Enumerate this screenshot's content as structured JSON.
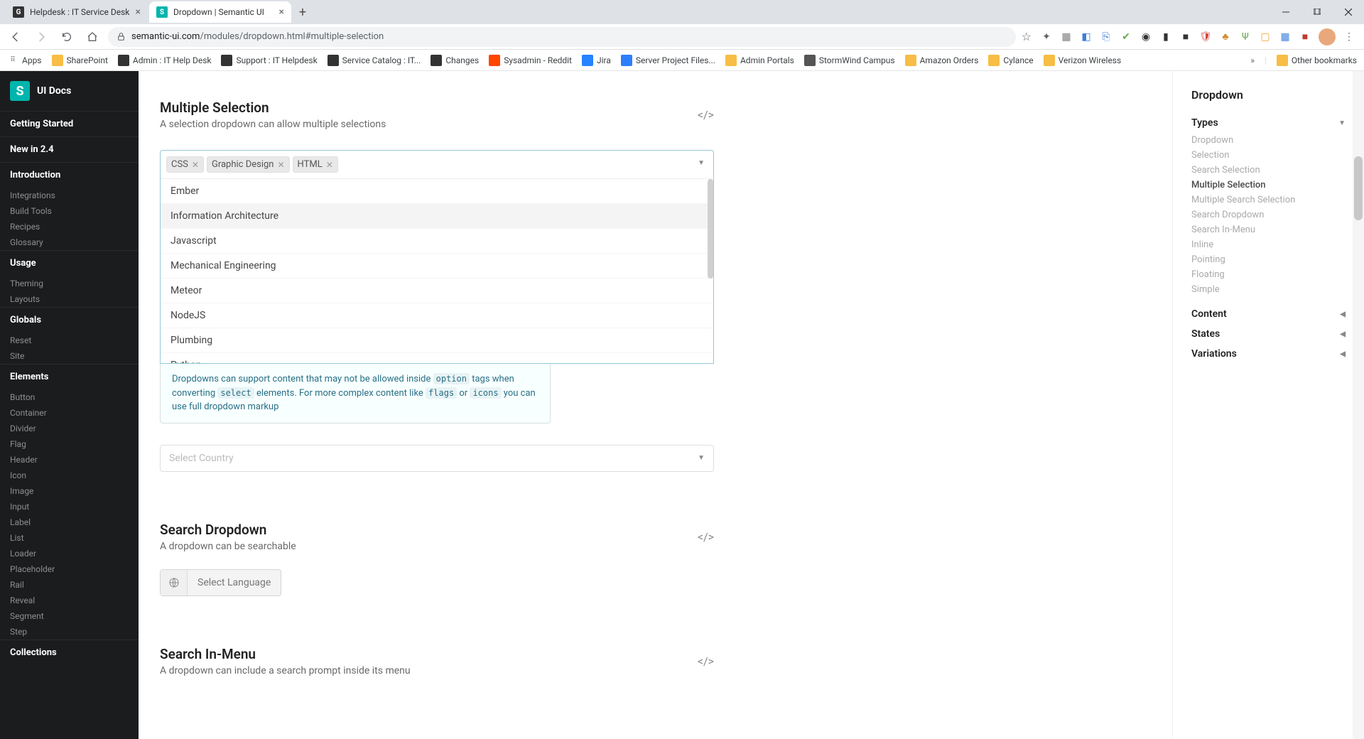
{
  "browser": {
    "tabs": [
      {
        "title": "Helpdesk : IT Service Desk",
        "active": false
      },
      {
        "title": "Dropdown | Semantic UI",
        "active": true
      }
    ],
    "url_host": "semantic-ui.com",
    "url_path": "/modules/dropdown.html#multiple-selection",
    "bookmarks": [
      "Apps",
      "SharePoint",
      "Admin : IT Help Desk",
      "Support : IT Helpdesk",
      "Service Catalog : IT...",
      "Changes",
      "Sysadmin - Reddit",
      "Jira",
      "Server Project Files...",
      "Admin Portals",
      "StormWind Campus",
      "Amazon Orders",
      "Cylance",
      "Verizon Wireless"
    ],
    "other_bookmarks": "Other bookmarks"
  },
  "sidebar": {
    "brand": "UI Docs",
    "groups": [
      {
        "header": "Getting Started",
        "items": []
      },
      {
        "header": "New in 2.4",
        "items": []
      },
      {
        "header": "Introduction",
        "items": [
          "Integrations",
          "Build Tools",
          "Recipes",
          "Glossary"
        ]
      },
      {
        "header": "Usage",
        "items": [
          "Theming",
          "Layouts"
        ]
      },
      {
        "header": "Globals",
        "items": [
          "Reset",
          "Site"
        ]
      },
      {
        "header": "Elements",
        "items": [
          "Button",
          "Container",
          "Divider",
          "Flag",
          "Header",
          "Icon",
          "Image",
          "Input",
          "Label",
          "List",
          "Loader",
          "Placeholder",
          "Rail",
          "Reveal",
          "Segment",
          "Step"
        ]
      },
      {
        "header": "Collections",
        "items": []
      }
    ]
  },
  "main": {
    "multi": {
      "title": "Multiple Selection",
      "sub": "A selection dropdown can allow multiple selections",
      "chips": [
        "CSS",
        "Graphic Design",
        "HTML"
      ],
      "options": [
        "Ember",
        "Information Architecture",
        "Javascript",
        "Mechanical Engineering",
        "Meteor",
        "NodeJS",
        "Plumbing",
        "Python"
      ],
      "hover_index": 1,
      "note_pre": "Dropdowns can support content that may not be allowed inside ",
      "note_code1": "option",
      "note_mid1": " tags when converting ",
      "note_code2": "select",
      "note_mid2": " elements. For more complex content like ",
      "note_code3": "flags",
      "note_mid3": " or ",
      "note_code4": "icons",
      "note_end": " you can use full dropdown markup"
    },
    "country_placeholder": "Select Country",
    "search": {
      "title": "Search Dropdown",
      "sub": "A dropdown can be searchable",
      "lang_label": "Select Language"
    },
    "inmenu": {
      "title": "Search In-Menu",
      "sub": "A dropdown can include a search prompt inside its menu"
    }
  },
  "toc": {
    "title": "Dropdown",
    "types_label": "Types",
    "types": [
      "Dropdown",
      "Selection",
      "Search Selection",
      "Multiple Selection",
      "Multiple Search Selection",
      "Search Dropdown",
      "Search In-Menu",
      "Inline",
      "Pointing",
      "Floating",
      "Simple"
    ],
    "active_index": 3,
    "groups": [
      "Content",
      "States",
      "Variations"
    ]
  }
}
